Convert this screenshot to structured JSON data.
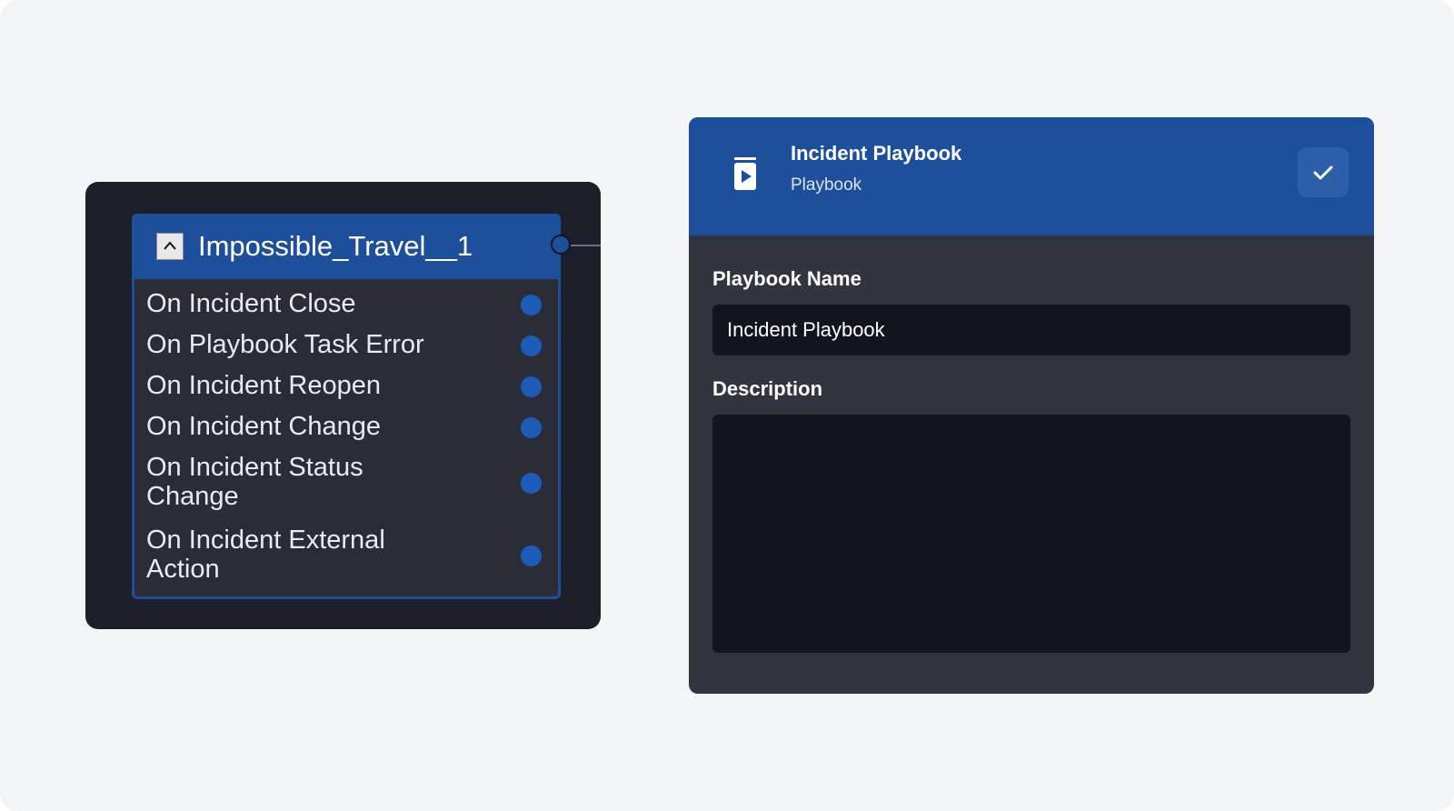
{
  "node": {
    "title": "Impossible_Travel__1",
    "triggers": [
      {
        "label": "On Incident Close"
      },
      {
        "label": "On Playbook Task Error"
      },
      {
        "label": "On Incident Reopen"
      },
      {
        "label": "On Incident Change"
      },
      {
        "label": "On Incident Status Change"
      },
      {
        "label": "On Incident External Action"
      }
    ]
  },
  "panel": {
    "title": "Incident Playbook",
    "subtitle": "Playbook",
    "name_label": "Playbook Name",
    "name_value": "Incident Playbook",
    "description_label": "Description",
    "description_value": ""
  },
  "icons": {
    "collapse": "chevron-up-icon",
    "playbook": "playbook-play-icon",
    "confirm": "checkmark-icon"
  },
  "colors": {
    "accent": "#1d4f9a",
    "port": "#1d5bb8",
    "canvas": "#f4f5f7",
    "node_bg": "#2a2d38",
    "panel_bg": "#32343f",
    "input_bg": "#12151e"
  }
}
